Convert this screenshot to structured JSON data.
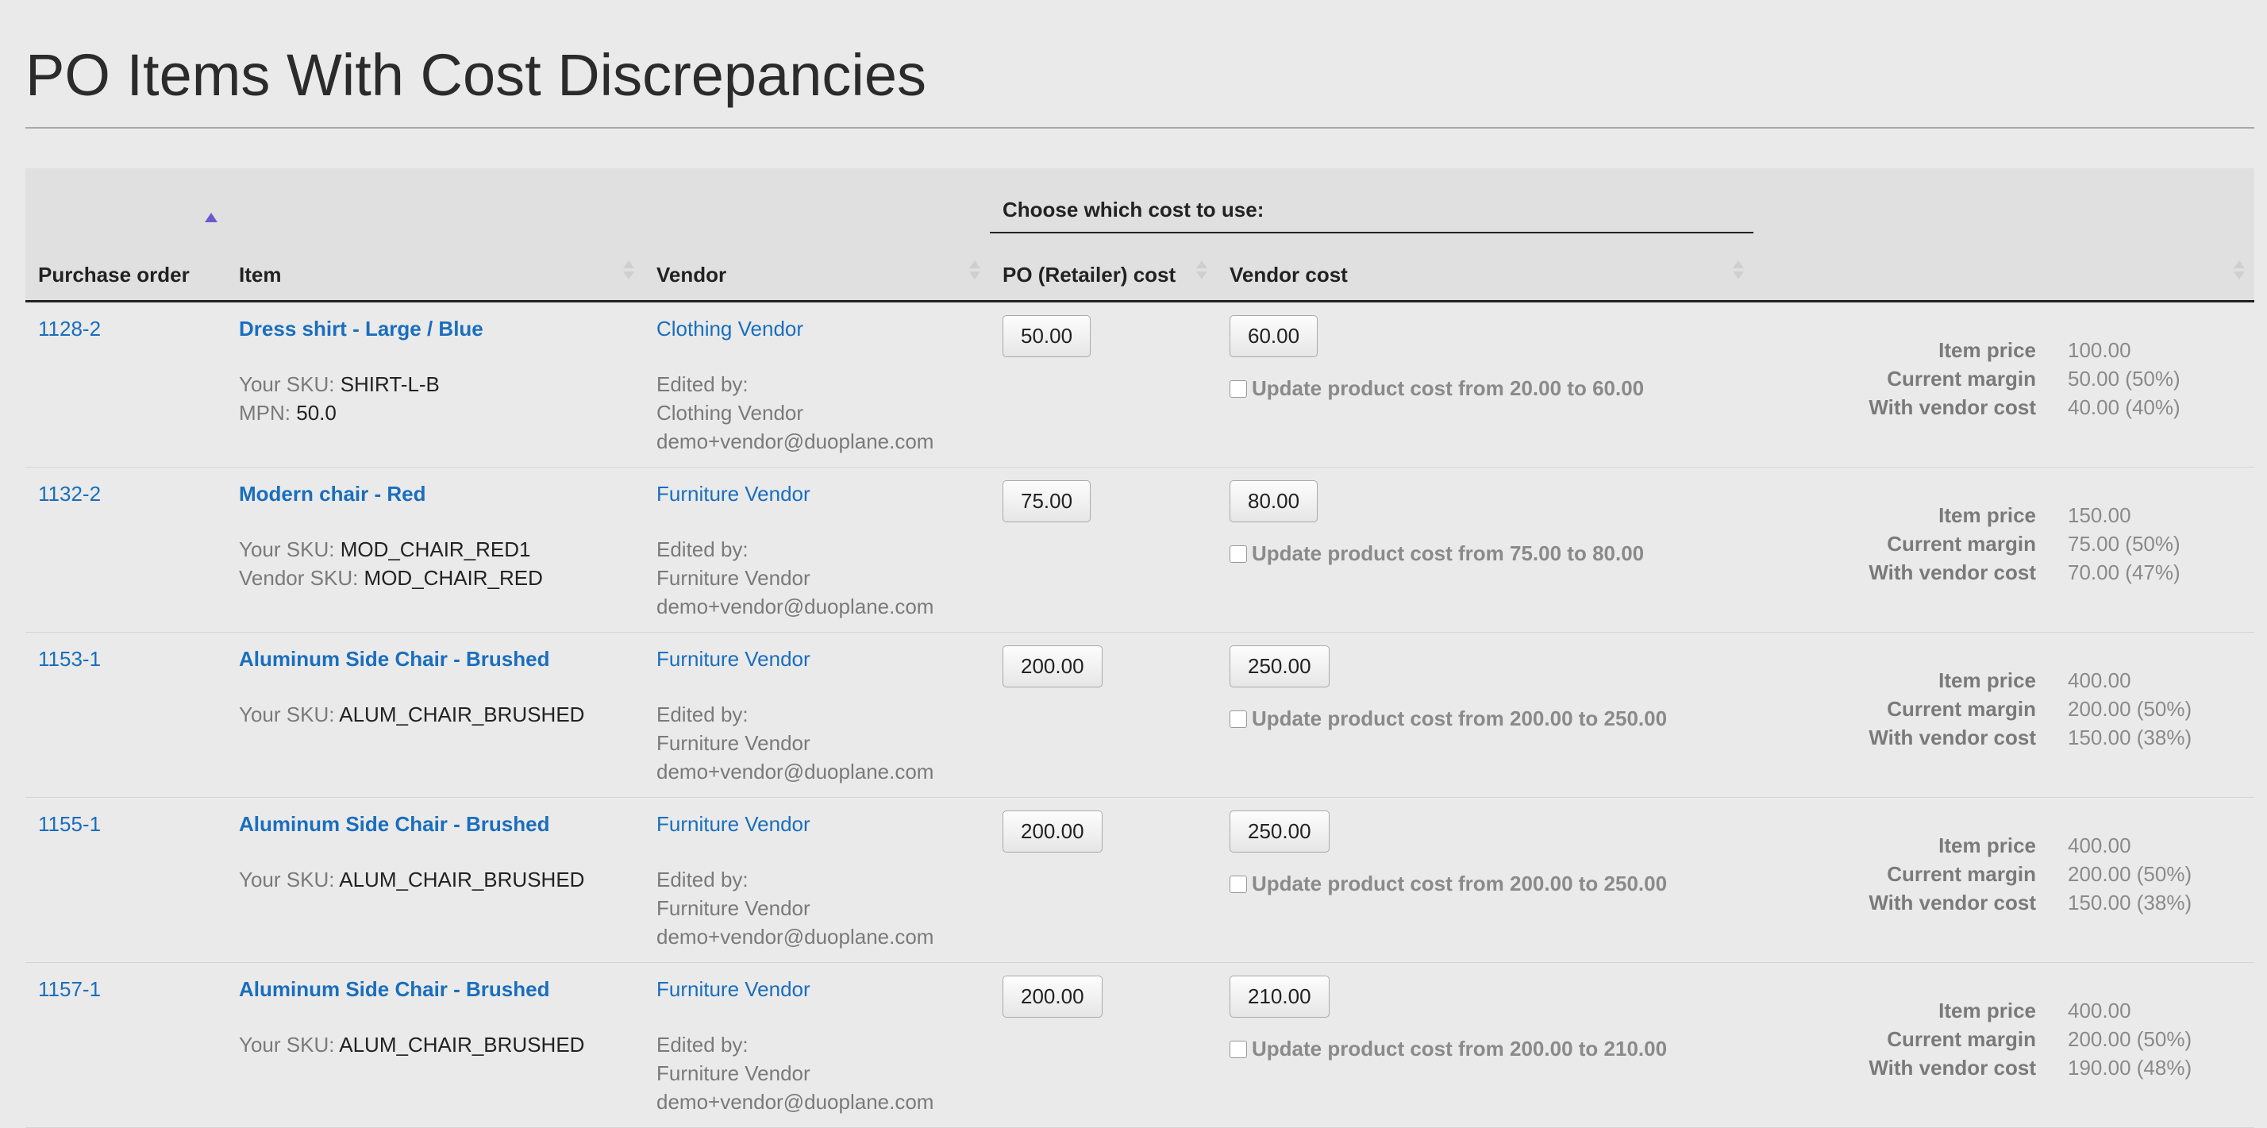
{
  "page_title": "PO Items With Cost Discrepancies",
  "table": {
    "group_header": "Choose which cost to use:",
    "columns": {
      "purchase_order": "Purchase order",
      "item": "Item",
      "vendor": "Vendor",
      "po_cost": "PO (Retailer) cost",
      "vendor_cost": "Vendor cost"
    },
    "labels": {
      "your_sku": "Your SKU:",
      "mpn": "MPN:",
      "vendor_sku": "Vendor SKU:",
      "edited_by": "Edited by:",
      "item_price": "Item price",
      "current_margin": "Current margin",
      "with_vendor_cost": "With vendor cost"
    },
    "rows": [
      {
        "po": "1128-2",
        "item": "Dress shirt - Large / Blue",
        "sku": "SHIRT-L-B",
        "extra_label": "MPN:",
        "extra_value": "50.0",
        "vendor": "Clothing Vendor",
        "edited_name": "Clothing Vendor",
        "edited_email": "demo+vendor@duoplane.com",
        "po_cost": "50.00",
        "vendor_cost": "60.00",
        "update_text": "Update product cost from 20.00 to 60.00",
        "item_price": "100.00",
        "current_margin": "50.00 (50%)",
        "with_vendor_cost": "40.00 (40%)"
      },
      {
        "po": "1132-2",
        "item": "Modern chair - Red",
        "sku": "MOD_CHAIR_RED1",
        "extra_label": "Vendor SKU:",
        "extra_value": "MOD_CHAIR_RED",
        "vendor": "Furniture Vendor",
        "edited_name": "Furniture Vendor",
        "edited_email": "demo+vendor@duoplane.com",
        "po_cost": "75.00",
        "vendor_cost": "80.00",
        "update_text": "Update product cost from 75.00 to 80.00",
        "item_price": "150.00",
        "current_margin": "75.00 (50%)",
        "with_vendor_cost": "70.00 (47%)"
      },
      {
        "po": "1153-1",
        "item": "Aluminum Side Chair - Brushed",
        "sku": "ALUM_CHAIR_BRUSHED",
        "extra_label": "",
        "extra_value": "",
        "vendor": "Furniture Vendor",
        "edited_name": "Furniture Vendor",
        "edited_email": "demo+vendor@duoplane.com",
        "po_cost": "200.00",
        "vendor_cost": "250.00",
        "update_text": "Update product cost from 200.00 to 250.00",
        "item_price": "400.00",
        "current_margin": "200.00 (50%)",
        "with_vendor_cost": "150.00 (38%)"
      },
      {
        "po": "1155-1",
        "item": "Aluminum Side Chair - Brushed",
        "sku": "ALUM_CHAIR_BRUSHED",
        "extra_label": "",
        "extra_value": "",
        "vendor": "Furniture Vendor",
        "edited_name": "Furniture Vendor",
        "edited_email": "demo+vendor@duoplane.com",
        "po_cost": "200.00",
        "vendor_cost": "250.00",
        "update_text": "Update product cost from 200.00 to 250.00",
        "item_price": "400.00",
        "current_margin": "200.00 (50%)",
        "with_vendor_cost": "150.00 (38%)"
      },
      {
        "po": "1157-1",
        "item": "Aluminum Side Chair - Brushed",
        "sku": "ALUM_CHAIR_BRUSHED",
        "extra_label": "",
        "extra_value": "",
        "vendor": "Furniture Vendor",
        "edited_name": "Furniture Vendor",
        "edited_email": "demo+vendor@duoplane.com",
        "po_cost": "200.00",
        "vendor_cost": "210.00",
        "update_text": "Update product cost from 200.00 to 210.00",
        "item_price": "400.00",
        "current_margin": "200.00 (50%)",
        "with_vendor_cost": "190.00 (48%)"
      }
    ]
  },
  "colors": {
    "link": "#1a6ebd",
    "sort_active": "#6a5acd",
    "background": "#eaeaea",
    "header_bg": "#e0e0e0"
  }
}
